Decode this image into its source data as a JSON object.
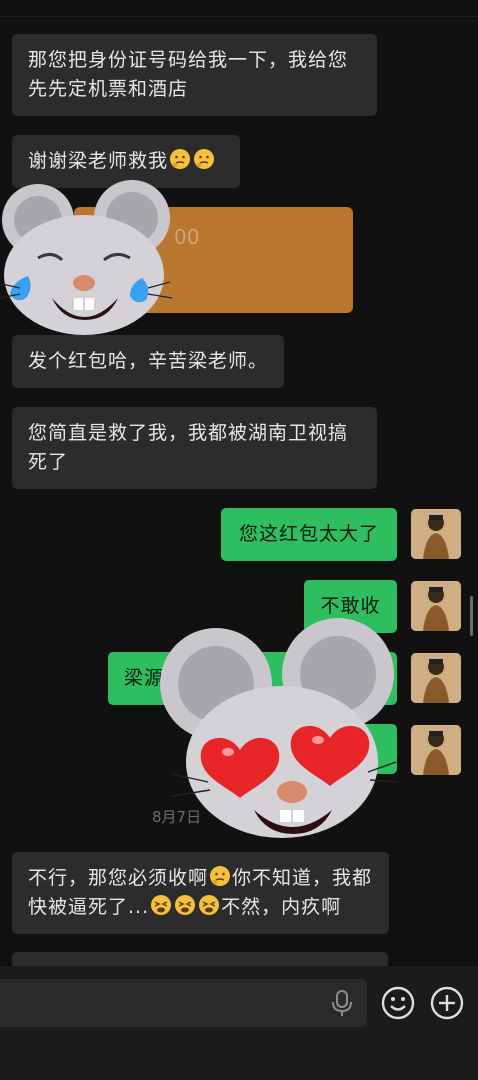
{
  "messages": {
    "m1": "那您把身份证号码给我一下，我给您先先定机票和酒店",
    "m2": "谢谢梁老师救我",
    "m3": "发个红包哈，辛苦梁老师。",
    "m4": "您简直是救了我，我都被湖南卫视搞死了",
    "s1": "您这红包太大了",
    "s2": "不敢收",
    "s3": "梁源",
    "m5a": "不行，那您必须收啊",
    "m5b": "你不知道，我都快被逼死了...",
    "m5c": "不然，内疚啊"
  },
  "red_packet": {
    "amount_fragment": "00"
  },
  "timestamp": "8月7日",
  "stickers": [
    "crying-mouse-sticker",
    "heart-eyes-mouse-sticker"
  ],
  "icons": [
    "thinking-face-emoji",
    "tired-face-emoji",
    "microphone-icon",
    "emoji-icon",
    "plus-icon"
  ],
  "colors": {
    "background": "#111111",
    "received_bubble": "#2c2c2c",
    "sent_bubble": "#2ebd5f",
    "red_packet": "#b9772f"
  }
}
